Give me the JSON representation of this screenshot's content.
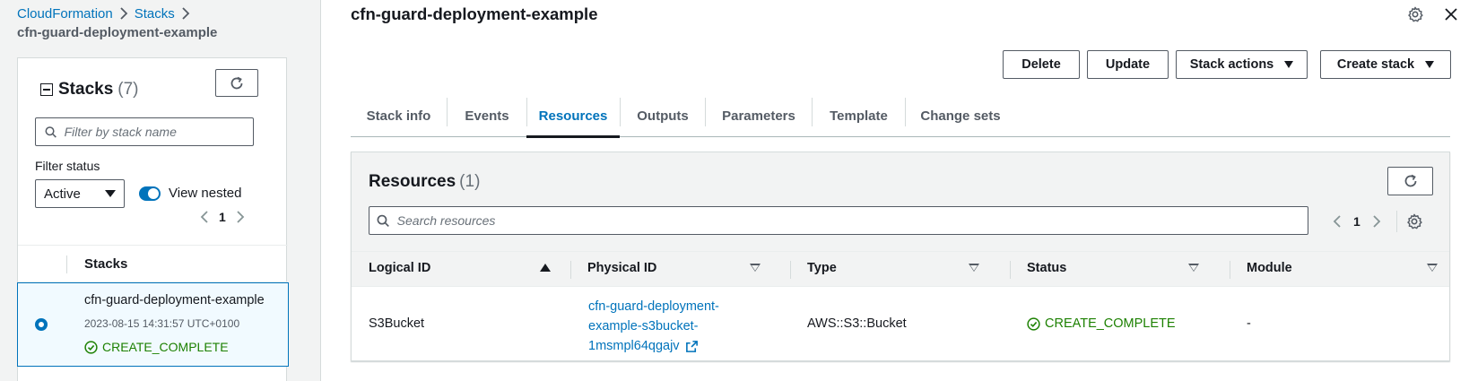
{
  "breadcrumb": {
    "items": [
      "CloudFormation",
      "Stacks"
    ],
    "current": "cfn-guard-deployment-example"
  },
  "stacks_panel": {
    "title": "Stacks",
    "count": "(7)",
    "filter_placeholder": "Filter by stack name",
    "filter_status_label": "Filter status",
    "filter_status_value": "Active",
    "view_nested_label": "View nested",
    "view_nested_on": true,
    "page": "1",
    "column_header": "Stacks",
    "stacks": [
      {
        "name": "cfn-guard-deployment-example",
        "timestamp": "2023-08-15 14:31:57 UTC+0100",
        "status": "CREATE_COMPLETE",
        "selected": true
      }
    ]
  },
  "detail": {
    "title": "cfn-guard-deployment-example",
    "buttons": {
      "delete": "Delete",
      "update": "Update",
      "stack_actions": "Stack actions",
      "create_stack": "Create stack"
    },
    "tabs": [
      "Stack info",
      "Events",
      "Resources",
      "Outputs",
      "Parameters",
      "Template",
      "Change sets"
    ],
    "active_tab": "Resources"
  },
  "resources": {
    "title": "Resources",
    "count": "(1)",
    "search_placeholder": "Search resources",
    "page": "1",
    "columns": [
      "Logical ID",
      "Physical ID",
      "Type",
      "Status",
      "Module"
    ],
    "rows": [
      {
        "logical_id": "S3Bucket",
        "physical_id_lines": [
          "cfn-guard-deployment-",
          "example-s3bucket-",
          "1msmpl64qgajv"
        ],
        "type": "AWS::S3::Bucket",
        "status": "CREATE_COMPLETE",
        "module": "-"
      }
    ]
  },
  "colors": {
    "link": "#0073bb",
    "success": "#1d8102",
    "selected_bg": "#f1faff",
    "panel_bg": "#f2f3f3"
  },
  "icons": [
    "refresh-icon",
    "search-icon",
    "chevron-left-icon",
    "chevron-right-icon",
    "settings-icon",
    "close-icon",
    "external-link-icon",
    "success-icon",
    "collapse-icon"
  ]
}
